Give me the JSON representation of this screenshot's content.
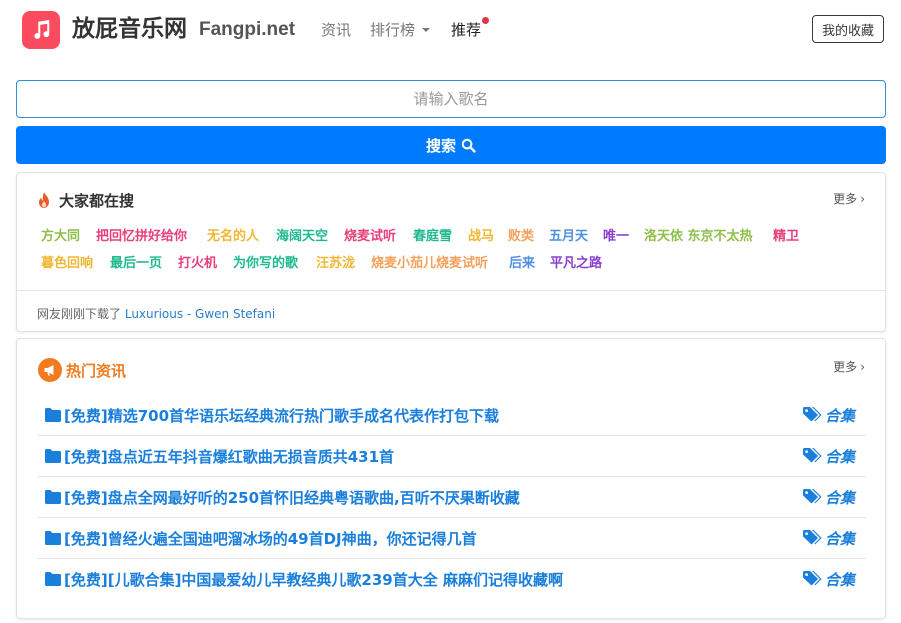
{
  "header": {
    "site_name": "放屁音乐网",
    "site_domain": "Fangpi.net",
    "nav": [
      {
        "label": "资讯"
      },
      {
        "label": "排行榜"
      },
      {
        "label": "推荐"
      }
    ],
    "favorites_label": "我的收藏"
  },
  "search": {
    "placeholder": "请输入歌名",
    "button_label": "搜索"
  },
  "trending": {
    "title": "大家都在搜",
    "more_label": "更多",
    "tags": [
      {
        "label": "方大同",
        "color": "#8fc04b"
      },
      {
        "label": "把回忆拼好给你",
        "color": "#e8407a"
      },
      {
        "label": "无名的人",
        "color": "#f0b733"
      },
      {
        "label": "海阔天空",
        "color": "#1fb98f"
      },
      {
        "label": "烧麦试听",
        "color": "#e8407a"
      },
      {
        "label": "春庭雪",
        "color": "#1fb98f"
      },
      {
        "label": "战马",
        "color": "#f0b733"
      },
      {
        "label": "败类",
        "color": "#f5a05a"
      },
      {
        "label": "五月天",
        "color": "#4f8fde"
      },
      {
        "label": "唯一",
        "color": "#8a3fd1"
      },
      {
        "label": "洛天依 东京不太热",
        "color": "#8fc04b"
      },
      {
        "label": "精卫",
        "color": "#e8407a"
      },
      {
        "label": "暮色回响",
        "color": "#f0b733"
      },
      {
        "label": "最后一页",
        "color": "#1fb98f"
      },
      {
        "label": "打火机",
        "color": "#e8407a"
      },
      {
        "label": "为你写的歌",
        "color": "#1fb98f"
      },
      {
        "label": "汪苏泷",
        "color": "#f0b733"
      },
      {
        "label": "烧麦小茄儿烧麦试听",
        "color": "#f5a05a"
      },
      {
        "label": "后来",
        "color": "#4f8fde"
      },
      {
        "label": "平凡之路",
        "color": "#8a3fd1"
      }
    ],
    "download_prefix": "网友刚刚下载了",
    "download_song": "Luxurious - Gwen Stefani"
  },
  "news": {
    "title": "热门资讯",
    "more_label": "更多",
    "items": [
      {
        "title": "[免费]精选700首华语乐坛经典流行热门歌手成名代表作打包下载",
        "category": "合集"
      },
      {
        "title": "[免费]盘点近五年抖音爆红歌曲无损音质共431首",
        "category": "合集"
      },
      {
        "title": "[免费]盘点全网最好听的250首怀旧经典粤语歌曲,百听不厌果断收藏",
        "category": "合集"
      },
      {
        "title": "[免费]曾经火遍全国迪吧溜冰场的49首DJ神曲，你还记得几首",
        "category": "合集"
      },
      {
        "title": "[免费][儿歌合集]中国最爱幼儿早教经典儿歌239首大全 麻麻们记得收藏啊",
        "category": "合集"
      }
    ]
  },
  "colors": {
    "brand": "#fb4b5e",
    "primary": "#007bff",
    "link": "#1a7fdb",
    "news_title": "#f07c1f",
    "flame": "#e85a2a"
  },
  "icons": {
    "logo": "music-note-icon",
    "search": "search-icon",
    "trending": "flame-icon",
    "news": "megaphone-icon",
    "news_item": "folder-icon",
    "category": "tags-icon"
  }
}
